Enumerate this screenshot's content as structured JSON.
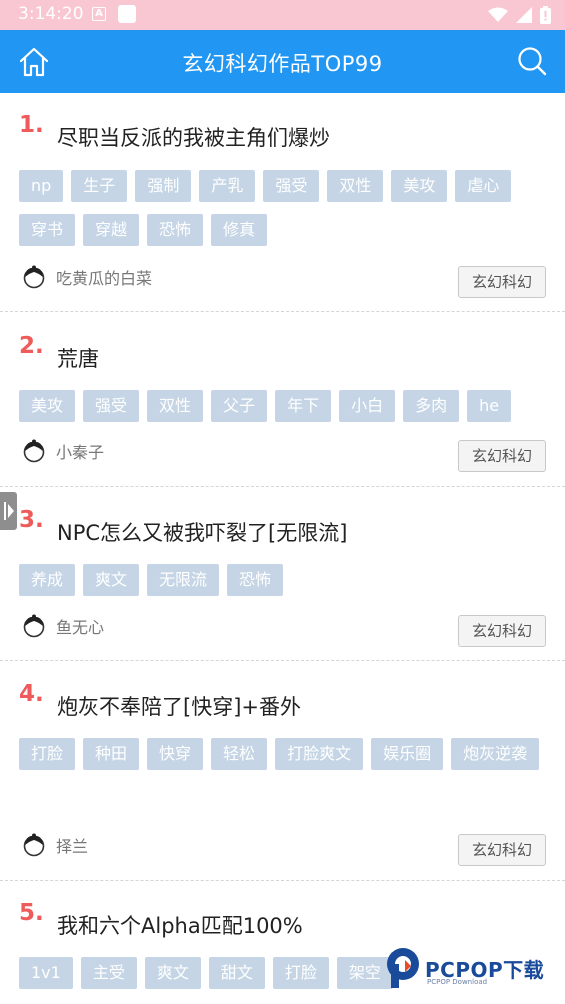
{
  "status_bar": {
    "time": "3:14:20",
    "a_label": "A"
  },
  "header": {
    "title": "玄幻科幻作品TOP99"
  },
  "works": [
    {
      "rank": "1.",
      "title": "尽职当反派的我被主角们爆炒",
      "tags": [
        "np",
        "生子",
        "强制",
        "产乳",
        "强受",
        "双性",
        "美攻",
        "虐心",
        "穿书",
        "穿越",
        "恐怖",
        "修真"
      ],
      "author": "吃黄瓜的白菜",
      "category": "玄幻科幻"
    },
    {
      "rank": "2.",
      "title": "荒唐",
      "tags": [
        "美攻",
        "强受",
        "双性",
        "父子",
        "年下",
        "小白",
        "多肉",
        "he"
      ],
      "author": "小秦子",
      "category": "玄幻科幻"
    },
    {
      "rank": "3.",
      "title": "NPC怎么又被我吓裂了[无限流]",
      "tags": [
        "养成",
        "爽文",
        "无限流",
        "恐怖"
      ],
      "author": "鱼无心",
      "category": "玄幻科幻"
    },
    {
      "rank": "4.",
      "title": "炮灰不奉陪了[快穿]+番外",
      "tags": [
        "打脸",
        "种田",
        "快穿",
        "轻松",
        "打脸爽文",
        "娱乐圈",
        "炮灰逆袭"
      ],
      "author": "择兰",
      "category": "玄幻科幻"
    },
    {
      "rank": "5.",
      "title": "我和六个Alpha匹配100%",
      "tags": [
        "1v1",
        "主受",
        "爽文",
        "甜文",
        "打脸",
        "架空"
      ],
      "author": "",
      "category": ""
    }
  ],
  "watermark": {
    "text": "PCPOP下载",
    "sub": "PCPOP Download"
  },
  "colors": {
    "header": "#2196f3",
    "status_bar": "#f8c7d2",
    "rank": "#ef5a5a",
    "tag_bg": "#c5d5e6"
  }
}
